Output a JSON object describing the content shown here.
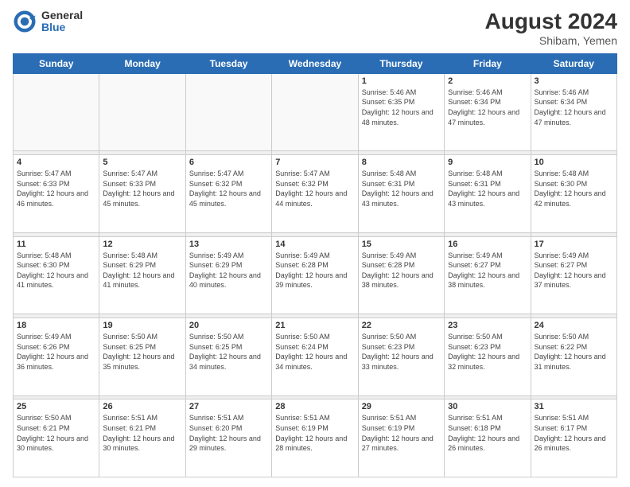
{
  "header": {
    "logo": {
      "general": "General",
      "blue": "Blue"
    },
    "title": "August 2024",
    "location": "Shibam, Yemen"
  },
  "weekdays": [
    "Sunday",
    "Monday",
    "Tuesday",
    "Wednesday",
    "Thursday",
    "Friday",
    "Saturday"
  ],
  "weeks": [
    [
      {
        "day": "",
        "sunrise": "",
        "sunset": "",
        "daylight": ""
      },
      {
        "day": "",
        "sunrise": "",
        "sunset": "",
        "daylight": ""
      },
      {
        "day": "",
        "sunrise": "",
        "sunset": "",
        "daylight": ""
      },
      {
        "day": "",
        "sunrise": "",
        "sunset": "",
        "daylight": ""
      },
      {
        "day": "1",
        "sunrise": "Sunrise: 5:46 AM",
        "sunset": "Sunset: 6:35 PM",
        "daylight": "Daylight: 12 hours and 48 minutes."
      },
      {
        "day": "2",
        "sunrise": "Sunrise: 5:46 AM",
        "sunset": "Sunset: 6:34 PM",
        "daylight": "Daylight: 12 hours and 47 minutes."
      },
      {
        "day": "3",
        "sunrise": "Sunrise: 5:46 AM",
        "sunset": "Sunset: 6:34 PM",
        "daylight": "Daylight: 12 hours and 47 minutes."
      }
    ],
    [
      {
        "day": "4",
        "sunrise": "Sunrise: 5:47 AM",
        "sunset": "Sunset: 6:33 PM",
        "daylight": "Daylight: 12 hours and 46 minutes."
      },
      {
        "day": "5",
        "sunrise": "Sunrise: 5:47 AM",
        "sunset": "Sunset: 6:33 PM",
        "daylight": "Daylight: 12 hours and 45 minutes."
      },
      {
        "day": "6",
        "sunrise": "Sunrise: 5:47 AM",
        "sunset": "Sunset: 6:32 PM",
        "daylight": "Daylight: 12 hours and 45 minutes."
      },
      {
        "day": "7",
        "sunrise": "Sunrise: 5:47 AM",
        "sunset": "Sunset: 6:32 PM",
        "daylight": "Daylight: 12 hours and 44 minutes."
      },
      {
        "day": "8",
        "sunrise": "Sunrise: 5:48 AM",
        "sunset": "Sunset: 6:31 PM",
        "daylight": "Daylight: 12 hours and 43 minutes."
      },
      {
        "day": "9",
        "sunrise": "Sunrise: 5:48 AM",
        "sunset": "Sunset: 6:31 PM",
        "daylight": "Daylight: 12 hours and 43 minutes."
      },
      {
        "day": "10",
        "sunrise": "Sunrise: 5:48 AM",
        "sunset": "Sunset: 6:30 PM",
        "daylight": "Daylight: 12 hours and 42 minutes."
      }
    ],
    [
      {
        "day": "11",
        "sunrise": "Sunrise: 5:48 AM",
        "sunset": "Sunset: 6:30 PM",
        "daylight": "Daylight: 12 hours and 41 minutes."
      },
      {
        "day": "12",
        "sunrise": "Sunrise: 5:48 AM",
        "sunset": "Sunset: 6:29 PM",
        "daylight": "Daylight: 12 hours and 41 minutes."
      },
      {
        "day": "13",
        "sunrise": "Sunrise: 5:49 AM",
        "sunset": "Sunset: 6:29 PM",
        "daylight": "Daylight: 12 hours and 40 minutes."
      },
      {
        "day": "14",
        "sunrise": "Sunrise: 5:49 AM",
        "sunset": "Sunset: 6:28 PM",
        "daylight": "Daylight: 12 hours and 39 minutes."
      },
      {
        "day": "15",
        "sunrise": "Sunrise: 5:49 AM",
        "sunset": "Sunset: 6:28 PM",
        "daylight": "Daylight: 12 hours and 38 minutes."
      },
      {
        "day": "16",
        "sunrise": "Sunrise: 5:49 AM",
        "sunset": "Sunset: 6:27 PM",
        "daylight": "Daylight: 12 hours and 38 minutes."
      },
      {
        "day": "17",
        "sunrise": "Sunrise: 5:49 AM",
        "sunset": "Sunset: 6:27 PM",
        "daylight": "Daylight: 12 hours and 37 minutes."
      }
    ],
    [
      {
        "day": "18",
        "sunrise": "Sunrise: 5:49 AM",
        "sunset": "Sunset: 6:26 PM",
        "daylight": "Daylight: 12 hours and 36 minutes."
      },
      {
        "day": "19",
        "sunrise": "Sunrise: 5:50 AM",
        "sunset": "Sunset: 6:25 PM",
        "daylight": "Daylight: 12 hours and 35 minutes."
      },
      {
        "day": "20",
        "sunrise": "Sunrise: 5:50 AM",
        "sunset": "Sunset: 6:25 PM",
        "daylight": "Daylight: 12 hours and 34 minutes."
      },
      {
        "day": "21",
        "sunrise": "Sunrise: 5:50 AM",
        "sunset": "Sunset: 6:24 PM",
        "daylight": "Daylight: 12 hours and 34 minutes."
      },
      {
        "day": "22",
        "sunrise": "Sunrise: 5:50 AM",
        "sunset": "Sunset: 6:23 PM",
        "daylight": "Daylight: 12 hours and 33 minutes."
      },
      {
        "day": "23",
        "sunrise": "Sunrise: 5:50 AM",
        "sunset": "Sunset: 6:23 PM",
        "daylight": "Daylight: 12 hours and 32 minutes."
      },
      {
        "day": "24",
        "sunrise": "Sunrise: 5:50 AM",
        "sunset": "Sunset: 6:22 PM",
        "daylight": "Daylight: 12 hours and 31 minutes."
      }
    ],
    [
      {
        "day": "25",
        "sunrise": "Sunrise: 5:50 AM",
        "sunset": "Sunset: 6:21 PM",
        "daylight": "Daylight: 12 hours and 30 minutes."
      },
      {
        "day": "26",
        "sunrise": "Sunrise: 5:51 AM",
        "sunset": "Sunset: 6:21 PM",
        "daylight": "Daylight: 12 hours and 30 minutes."
      },
      {
        "day": "27",
        "sunrise": "Sunrise: 5:51 AM",
        "sunset": "Sunset: 6:20 PM",
        "daylight": "Daylight: 12 hours and 29 minutes."
      },
      {
        "day": "28",
        "sunrise": "Sunrise: 5:51 AM",
        "sunset": "Sunset: 6:19 PM",
        "daylight": "Daylight: 12 hours and 28 minutes."
      },
      {
        "day": "29",
        "sunrise": "Sunrise: 5:51 AM",
        "sunset": "Sunset: 6:19 PM",
        "daylight": "Daylight: 12 hours and 27 minutes."
      },
      {
        "day": "30",
        "sunrise": "Sunrise: 5:51 AM",
        "sunset": "Sunset: 6:18 PM",
        "daylight": "Daylight: 12 hours and 26 minutes."
      },
      {
        "day": "31",
        "sunrise": "Sunrise: 5:51 AM",
        "sunset": "Sunset: 6:17 PM",
        "daylight": "Daylight: 12 hours and 26 minutes."
      }
    ]
  ]
}
